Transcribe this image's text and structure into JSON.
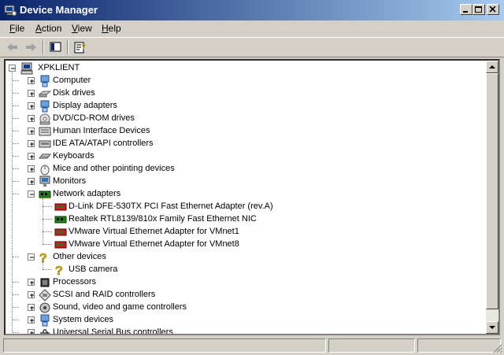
{
  "window": {
    "title": "Device Manager"
  },
  "menu": [
    {
      "label": "File",
      "key": "F",
      "rest": "ile"
    },
    {
      "label": "Action",
      "key": "A",
      "rest": "ction"
    },
    {
      "label": "View",
      "key": "V",
      "rest": "iew"
    },
    {
      "label": "Help",
      "key": "H",
      "rest": "elp"
    }
  ],
  "tree": {
    "root": "XPKLIENT",
    "categories": [
      {
        "label": "Computer",
        "icon": "computer-icon",
        "expanded": false
      },
      {
        "label": "Disk drives",
        "icon": "disk-drive-icon",
        "expanded": false
      },
      {
        "label": "Display adapters",
        "icon": "display-adapter-icon",
        "expanded": false
      },
      {
        "label": "DVD/CD-ROM drives",
        "icon": "cdrom-icon",
        "expanded": false
      },
      {
        "label": "Human Interface Devices",
        "icon": "hid-icon",
        "expanded": false
      },
      {
        "label": "IDE ATA/ATAPI controllers",
        "icon": "ide-controller-icon",
        "expanded": false
      },
      {
        "label": "Keyboards",
        "icon": "keyboard-icon",
        "expanded": false
      },
      {
        "label": "Mice and other pointing devices",
        "icon": "mouse-icon",
        "expanded": false
      },
      {
        "label": "Monitors",
        "icon": "monitor-icon",
        "expanded": false
      },
      {
        "label": "Network adapters",
        "icon": "network-adapter-icon",
        "expanded": true,
        "children": [
          "D-Link DFE-530TX PCI Fast Ethernet Adapter (rev.A)",
          "Realtek RTL8139/810x Family Fast Ethernet NIC",
          "VMware Virtual Ethernet Adapter for VMnet1",
          "VMware Virtual Ethernet Adapter for VMnet8"
        ]
      },
      {
        "label": "Other devices",
        "icon": "unknown-device-icon",
        "expanded": true,
        "children": [
          "USB camera"
        ]
      },
      {
        "label": "Processors",
        "icon": "processor-icon",
        "expanded": false
      },
      {
        "label": "SCSI and RAID controllers",
        "icon": "scsi-icon",
        "expanded": false
      },
      {
        "label": "Sound, video and game controllers",
        "icon": "sound-icon",
        "expanded": false
      },
      {
        "label": "System devices",
        "icon": "system-device-icon",
        "expanded": false
      },
      {
        "label": "Universal Serial Bus controllers",
        "icon": "usb-icon",
        "expanded": false
      }
    ]
  },
  "colors": {
    "title_start": "#0a246a",
    "title_end": "#a6caf0",
    "chrome": "#d4d0c8"
  }
}
